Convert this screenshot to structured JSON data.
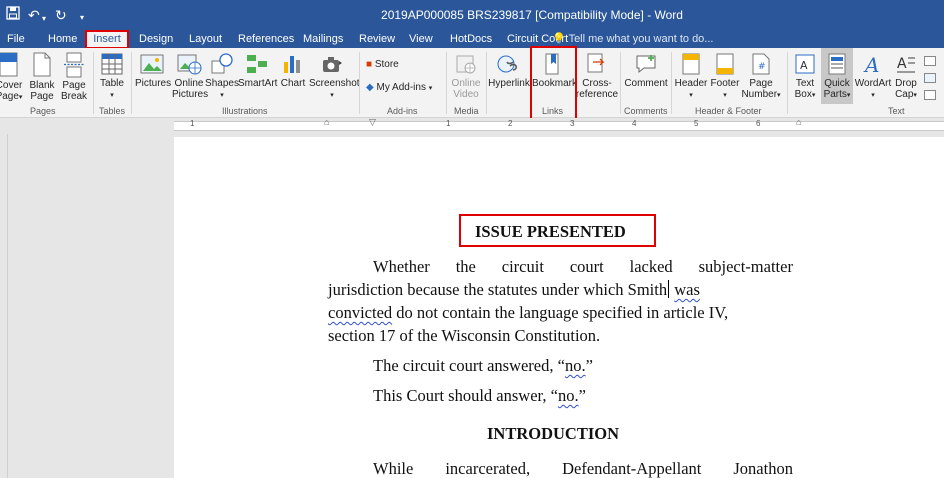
{
  "window": {
    "title": "2019AP000085 BRS239817 [Compatibility Mode] - Word"
  },
  "tabs": [
    {
      "label": "File"
    },
    {
      "label": "Home"
    },
    {
      "label": "Insert"
    },
    {
      "label": "Design"
    },
    {
      "label": "Layout"
    },
    {
      "label": "References"
    },
    {
      "label": "Mailings"
    },
    {
      "label": "Review"
    },
    {
      "label": "View"
    },
    {
      "label": "HotDocs"
    },
    {
      "label": "Circuit Court"
    }
  ],
  "active_tab": "Insert",
  "tell_me": "Tell me what you want to do...",
  "ribbon": {
    "pages": {
      "cover_l1": "Cover",
      "cover_l2": "Page",
      "blank_l1": "Blank",
      "blank_l2": "Page",
      "break_l1": "Page",
      "break_l2": "Break",
      "group": "Pages"
    },
    "tables": {
      "table": "Table",
      "group": "Tables"
    },
    "illustrations": {
      "pictures": "Pictures",
      "online_l1": "Online",
      "online_l2": "Pictures",
      "shapes": "Shapes",
      "smartart": "SmartArt",
      "chart": "Chart",
      "screenshot": "Screenshot",
      "group": "Illustrations"
    },
    "addins": {
      "store": "Store",
      "my_addins": "My Add-ins",
      "group": "Add-ins"
    },
    "media": {
      "online_l1": "Online",
      "online_l2": "Video",
      "group": "Media"
    },
    "links": {
      "hyperlink": "Hyperlink",
      "bookmark": "Bookmark",
      "cross_l1": "Cross-",
      "cross_l2": "reference",
      "group": "Links"
    },
    "comments": {
      "comment": "Comment",
      "group": "Comments"
    },
    "header_footer": {
      "header": "Header",
      "footer": "Footer",
      "pnum_l1": "Page",
      "pnum_l2": "Number",
      "group": "Header & Footer"
    },
    "text": {
      "textbox_l1": "Text",
      "textbox_l2": "Box",
      "quick_l1": "Quick",
      "quick_l2": "Parts",
      "wordart": "WordArt",
      "dropcap_l1": "Drop",
      "dropcap_l2": "Cap",
      "group": "Text"
    }
  },
  "ruler": {
    "numbers": [
      "1",
      "1",
      "2",
      "3",
      "4",
      "5",
      "6"
    ]
  },
  "document": {
    "heading1": "ISSUE PRESENTED",
    "para1_line1": [
      "Whether",
      "the",
      "circuit",
      "court",
      "lacked",
      "subject-matter"
    ],
    "para1_line2_a": "jurisdiction because the statutes under which Smith",
    "para1_line2_b": "was",
    "para1_line3_a": "convicted",
    "para1_line3_b": " do not contain the language specified in article IV,",
    "para1_line4": "section 17 of the Wisconsin Constitution.",
    "answer1_a": "The circuit court answered, “",
    "answer1_b": "no.",
    "answer1_c": "”",
    "answer2_a": "This Court should answer, “",
    "answer2_b": "no.",
    "answer2_c": "”",
    "heading2": "INTRODUCTION",
    "para2_line1": [
      "While",
      "incarcerated,",
      "Defendant-Appellant",
      "Jonathon"
    ]
  },
  "colors": {
    "word_blue": "#2b579a",
    "highlight_red": "#e00000",
    "ribbon_bg": "#f3f3f3",
    "spell_squiggle": "#2f4fd0"
  }
}
